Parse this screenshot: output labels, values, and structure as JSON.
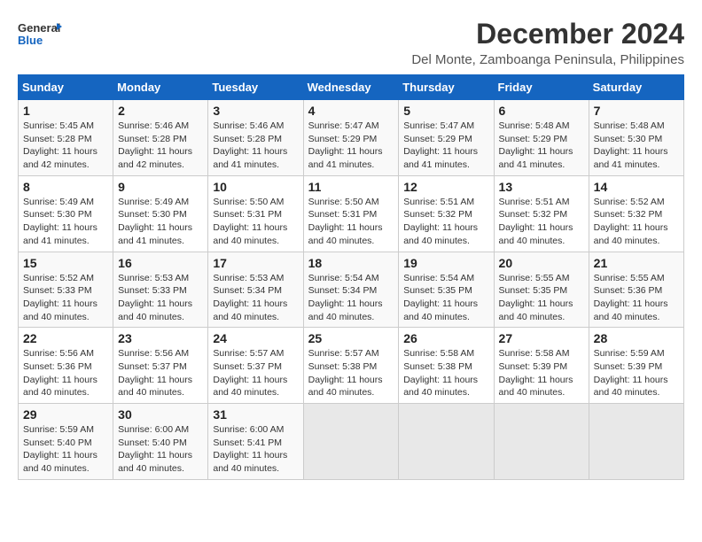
{
  "logo": {
    "general": "General",
    "blue": "Blue"
  },
  "title": "December 2024",
  "subtitle": "Del Monte, Zamboanga Peninsula, Philippines",
  "days_of_week": [
    "Sunday",
    "Monday",
    "Tuesday",
    "Wednesday",
    "Thursday",
    "Friday",
    "Saturday"
  ],
  "weeks": [
    [
      {
        "day": "1",
        "sunrise": "5:45 AM",
        "sunset": "5:28 PM",
        "daylight": "11 hours and 42 minutes."
      },
      {
        "day": "2",
        "sunrise": "5:46 AM",
        "sunset": "5:28 PM",
        "daylight": "11 hours and 42 minutes."
      },
      {
        "day": "3",
        "sunrise": "5:46 AM",
        "sunset": "5:28 PM",
        "daylight": "11 hours and 41 minutes."
      },
      {
        "day": "4",
        "sunrise": "5:47 AM",
        "sunset": "5:29 PM",
        "daylight": "11 hours and 41 minutes."
      },
      {
        "day": "5",
        "sunrise": "5:47 AM",
        "sunset": "5:29 PM",
        "daylight": "11 hours and 41 minutes."
      },
      {
        "day": "6",
        "sunrise": "5:48 AM",
        "sunset": "5:29 PM",
        "daylight": "11 hours and 41 minutes."
      },
      {
        "day": "7",
        "sunrise": "5:48 AM",
        "sunset": "5:30 PM",
        "daylight": "11 hours and 41 minutes."
      }
    ],
    [
      {
        "day": "8",
        "sunrise": "5:49 AM",
        "sunset": "5:30 PM",
        "daylight": "11 hours and 41 minutes."
      },
      {
        "day": "9",
        "sunrise": "5:49 AM",
        "sunset": "5:30 PM",
        "daylight": "11 hours and 41 minutes."
      },
      {
        "day": "10",
        "sunrise": "5:50 AM",
        "sunset": "5:31 PM",
        "daylight": "11 hours and 40 minutes."
      },
      {
        "day": "11",
        "sunrise": "5:50 AM",
        "sunset": "5:31 PM",
        "daylight": "11 hours and 40 minutes."
      },
      {
        "day": "12",
        "sunrise": "5:51 AM",
        "sunset": "5:32 PM",
        "daylight": "11 hours and 40 minutes."
      },
      {
        "day": "13",
        "sunrise": "5:51 AM",
        "sunset": "5:32 PM",
        "daylight": "11 hours and 40 minutes."
      },
      {
        "day": "14",
        "sunrise": "5:52 AM",
        "sunset": "5:32 PM",
        "daylight": "11 hours and 40 minutes."
      }
    ],
    [
      {
        "day": "15",
        "sunrise": "5:52 AM",
        "sunset": "5:33 PM",
        "daylight": "11 hours and 40 minutes."
      },
      {
        "day": "16",
        "sunrise": "5:53 AM",
        "sunset": "5:33 PM",
        "daylight": "11 hours and 40 minutes."
      },
      {
        "day": "17",
        "sunrise": "5:53 AM",
        "sunset": "5:34 PM",
        "daylight": "11 hours and 40 minutes."
      },
      {
        "day": "18",
        "sunrise": "5:54 AM",
        "sunset": "5:34 PM",
        "daylight": "11 hours and 40 minutes."
      },
      {
        "day": "19",
        "sunrise": "5:54 AM",
        "sunset": "5:35 PM",
        "daylight": "11 hours and 40 minutes."
      },
      {
        "day": "20",
        "sunrise": "5:55 AM",
        "sunset": "5:35 PM",
        "daylight": "11 hours and 40 minutes."
      },
      {
        "day": "21",
        "sunrise": "5:55 AM",
        "sunset": "5:36 PM",
        "daylight": "11 hours and 40 minutes."
      }
    ],
    [
      {
        "day": "22",
        "sunrise": "5:56 AM",
        "sunset": "5:36 PM",
        "daylight": "11 hours and 40 minutes."
      },
      {
        "day": "23",
        "sunrise": "5:56 AM",
        "sunset": "5:37 PM",
        "daylight": "11 hours and 40 minutes."
      },
      {
        "day": "24",
        "sunrise": "5:57 AM",
        "sunset": "5:37 PM",
        "daylight": "11 hours and 40 minutes."
      },
      {
        "day": "25",
        "sunrise": "5:57 AM",
        "sunset": "5:38 PM",
        "daylight": "11 hours and 40 minutes."
      },
      {
        "day": "26",
        "sunrise": "5:58 AM",
        "sunset": "5:38 PM",
        "daylight": "11 hours and 40 minutes."
      },
      {
        "day": "27",
        "sunrise": "5:58 AM",
        "sunset": "5:39 PM",
        "daylight": "11 hours and 40 minutes."
      },
      {
        "day": "28",
        "sunrise": "5:59 AM",
        "sunset": "5:39 PM",
        "daylight": "11 hours and 40 minutes."
      }
    ],
    [
      {
        "day": "29",
        "sunrise": "5:59 AM",
        "sunset": "5:40 PM",
        "daylight": "11 hours and 40 minutes."
      },
      {
        "day": "30",
        "sunrise": "6:00 AM",
        "sunset": "5:40 PM",
        "daylight": "11 hours and 40 minutes."
      },
      {
        "day": "31",
        "sunrise": "6:00 AM",
        "sunset": "5:41 PM",
        "daylight": "11 hours and 40 minutes."
      },
      null,
      null,
      null,
      null
    ]
  ],
  "labels": {
    "sunrise": "Sunrise:",
    "sunset": "Sunset:",
    "daylight": "Daylight:"
  }
}
